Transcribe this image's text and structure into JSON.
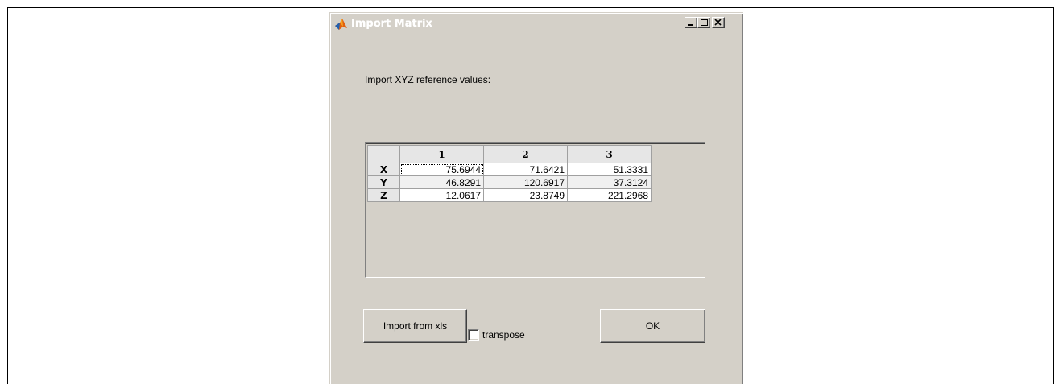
{
  "window": {
    "title": "Import Matrix"
  },
  "prompt": "Import XYZ reference values:",
  "table": {
    "columns": [
      "1",
      "2",
      "3"
    ],
    "rows": [
      {
        "label": "X",
        "values": [
          "75.6944",
          "71.6421",
          "51.3331"
        ]
      },
      {
        "label": "Y",
        "values": [
          "46.8291",
          "120.6917",
          "37.3124"
        ]
      },
      {
        "label": "Z",
        "values": [
          "12.0617",
          "23.8749",
          "221.2968"
        ]
      }
    ]
  },
  "buttons": {
    "import_label": "Import from xls",
    "ok_label": "OK"
  },
  "transpose": {
    "label": "transpose",
    "checked": false
  },
  "colors": {
    "dialog_bg": "#d4d0c8",
    "title_text": "#ffffff"
  },
  "icons": {
    "app": "matlab-logo-icon",
    "minimize": "minimize-icon",
    "maximize": "maximize-icon",
    "close": "close-icon"
  }
}
